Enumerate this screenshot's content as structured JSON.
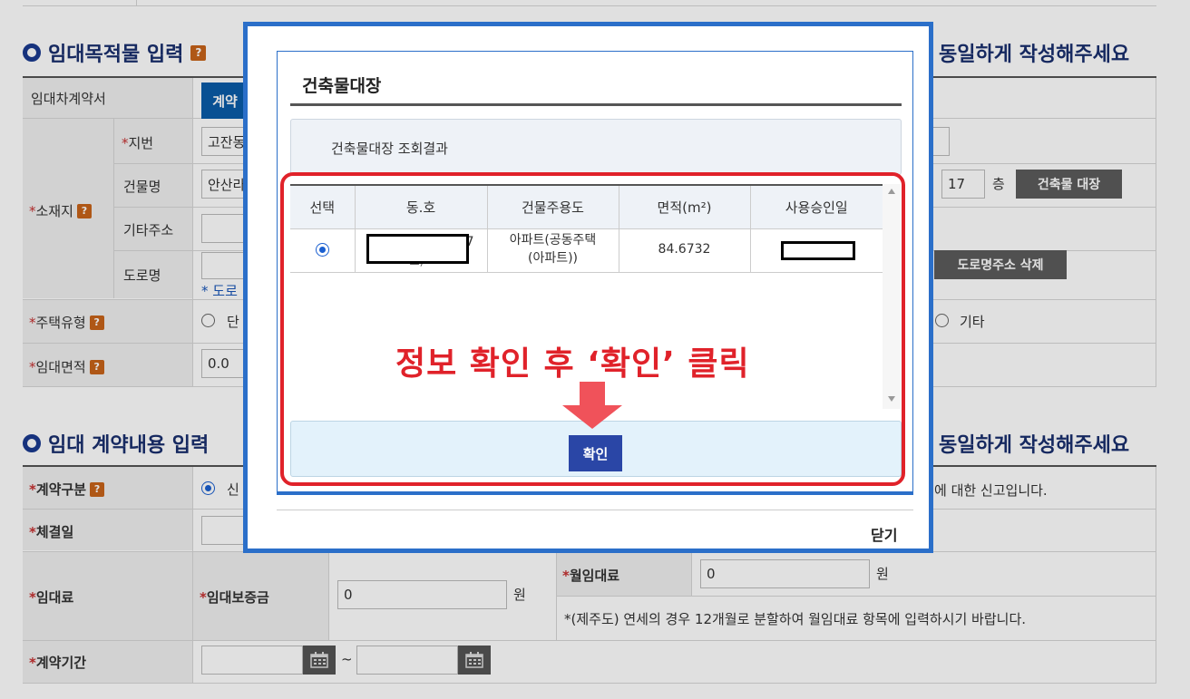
{
  "section1": {
    "title": "임대목적물 입력",
    "right_note": "동일하게 작성해주세요",
    "help": "?",
    "rows": {
      "contract_doc_label": "임대차계약서",
      "contract_doc_button": "계약",
      "address_label": "소재지",
      "lot_label": "지번",
      "lot_value": "고잔동",
      "building_label": "건물명",
      "building_value": "안산라",
      "floor_value": "17",
      "floor_unit": "층",
      "building_register_button": "건축물 대장",
      "other_address_label": "기타주소",
      "road_label": "도로명",
      "road_link": "* 도로",
      "delete_road_button": "도로명주소 삭제",
      "housing_type_label": "주택유형",
      "housing_type_option_first": "단",
      "housing_type_option_other": "기타",
      "area_label": "임대면적",
      "area_value": "0.0"
    }
  },
  "section2": {
    "title": "임대 계약내용 입력",
    "right_note": "동일하게 작성해주세요",
    "rows": {
      "contract_type_label": "계약구분",
      "contract_type_option": "신",
      "contract_type_note": "에 대한 신고입니다.",
      "signed_date_label": "체결일",
      "rent_label": "임대료",
      "deposit_label": "임대보증금",
      "deposit_value": "0",
      "won": "원",
      "monthly_rent_label": "월임대료",
      "monthly_rent_value": "0",
      "jeju_note": "*(제주도) 연세의 경우 12개월로 분할하여 월임대료 항목에 입력하시기 바랍니다.",
      "period_label": "계약기간",
      "tilde": "~"
    }
  },
  "modal": {
    "title": "건축물대장",
    "result_label": "건축물대장 조회결과",
    "columns": [
      "선택",
      "동.호",
      "건물주용도",
      "면적(m²)",
      "사용승인일"
    ],
    "row": {
      "selected": true,
      "dong_ho_visible": "7",
      "dong_ho_second_line": "호)",
      "usage": "아파트(공동주택\n(아파트))",
      "area": "84.6732"
    },
    "confirm_button": "확인",
    "close_button": "닫기"
  },
  "annotation": {
    "text": "정보 확인 후 ‘확인’ 클릭",
    "color": "#e0222a"
  },
  "colors": {
    "section_title": "#1a2f6e",
    "modal_border": "#2b6fc9",
    "confirm_button": "#2a46a6",
    "help_badge": "#c8641a",
    "primary_button": "#0a5ca8"
  }
}
